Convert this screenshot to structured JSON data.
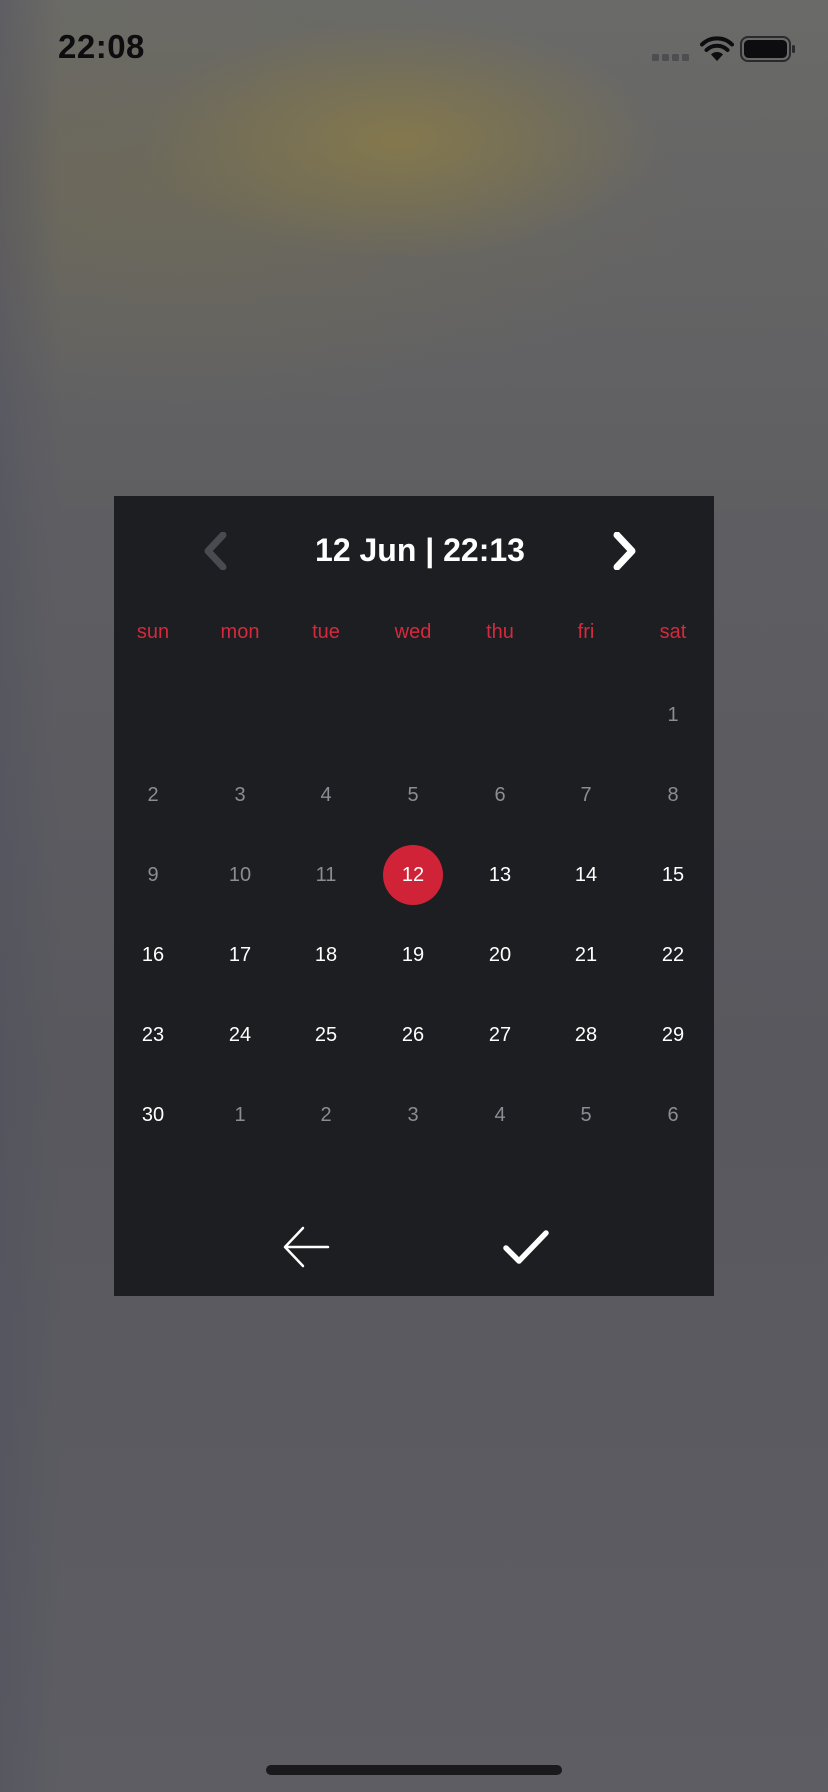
{
  "status_bar": {
    "time": "22:08"
  },
  "picker": {
    "title": "12 Jun | 22:13",
    "weekdays": [
      "sun",
      "mon",
      "tue",
      "wed",
      "thu",
      "fri",
      "sat"
    ],
    "weeks": [
      [
        {
          "label": "",
          "state": "empty"
        },
        {
          "label": "",
          "state": "empty"
        },
        {
          "label": "",
          "state": "empty"
        },
        {
          "label": "",
          "state": "empty"
        },
        {
          "label": "",
          "state": "empty"
        },
        {
          "label": "",
          "state": "empty"
        },
        {
          "label": "1",
          "state": "muted"
        }
      ],
      [
        {
          "label": "2",
          "state": "muted"
        },
        {
          "label": "3",
          "state": "muted"
        },
        {
          "label": "4",
          "state": "muted"
        },
        {
          "label": "5",
          "state": "muted"
        },
        {
          "label": "6",
          "state": "muted"
        },
        {
          "label": "7",
          "state": "muted"
        },
        {
          "label": "8",
          "state": "muted"
        }
      ],
      [
        {
          "label": "9",
          "state": "muted"
        },
        {
          "label": "10",
          "state": "muted"
        },
        {
          "label": "11",
          "state": "muted"
        },
        {
          "label": "12",
          "state": "selected"
        },
        {
          "label": "13",
          "state": "active"
        },
        {
          "label": "14",
          "state": "active"
        },
        {
          "label": "15",
          "state": "active"
        }
      ],
      [
        {
          "label": "16",
          "state": "active"
        },
        {
          "label": "17",
          "state": "active"
        },
        {
          "label": "18",
          "state": "active"
        },
        {
          "label": "19",
          "state": "active"
        },
        {
          "label": "20",
          "state": "active"
        },
        {
          "label": "21",
          "state": "active"
        },
        {
          "label": "22",
          "state": "active"
        }
      ],
      [
        {
          "label": "23",
          "state": "active"
        },
        {
          "label": "24",
          "state": "active"
        },
        {
          "label": "25",
          "state": "active"
        },
        {
          "label": "26",
          "state": "active"
        },
        {
          "label": "27",
          "state": "active"
        },
        {
          "label": "28",
          "state": "active"
        },
        {
          "label": "29",
          "state": "active"
        }
      ],
      [
        {
          "label": "30",
          "state": "active"
        },
        {
          "label": "1",
          "state": "muted"
        },
        {
          "label": "2",
          "state": "muted"
        },
        {
          "label": "3",
          "state": "muted"
        },
        {
          "label": "4",
          "state": "muted"
        },
        {
          "label": "5",
          "state": "muted"
        },
        {
          "label": "6",
          "state": "muted"
        }
      ]
    ],
    "prev_icon": "chevron-left-icon",
    "next_icon": "chevron-right-icon",
    "back_icon": "arrow-left-icon",
    "confirm_icon": "checkmark-icon"
  },
  "colors": {
    "accent": "#d12338",
    "weekday": "#d5293d",
    "panel": "#1d1e21",
    "muted_day": "#8c8c92",
    "disabled_nav": "#4a4b50"
  }
}
